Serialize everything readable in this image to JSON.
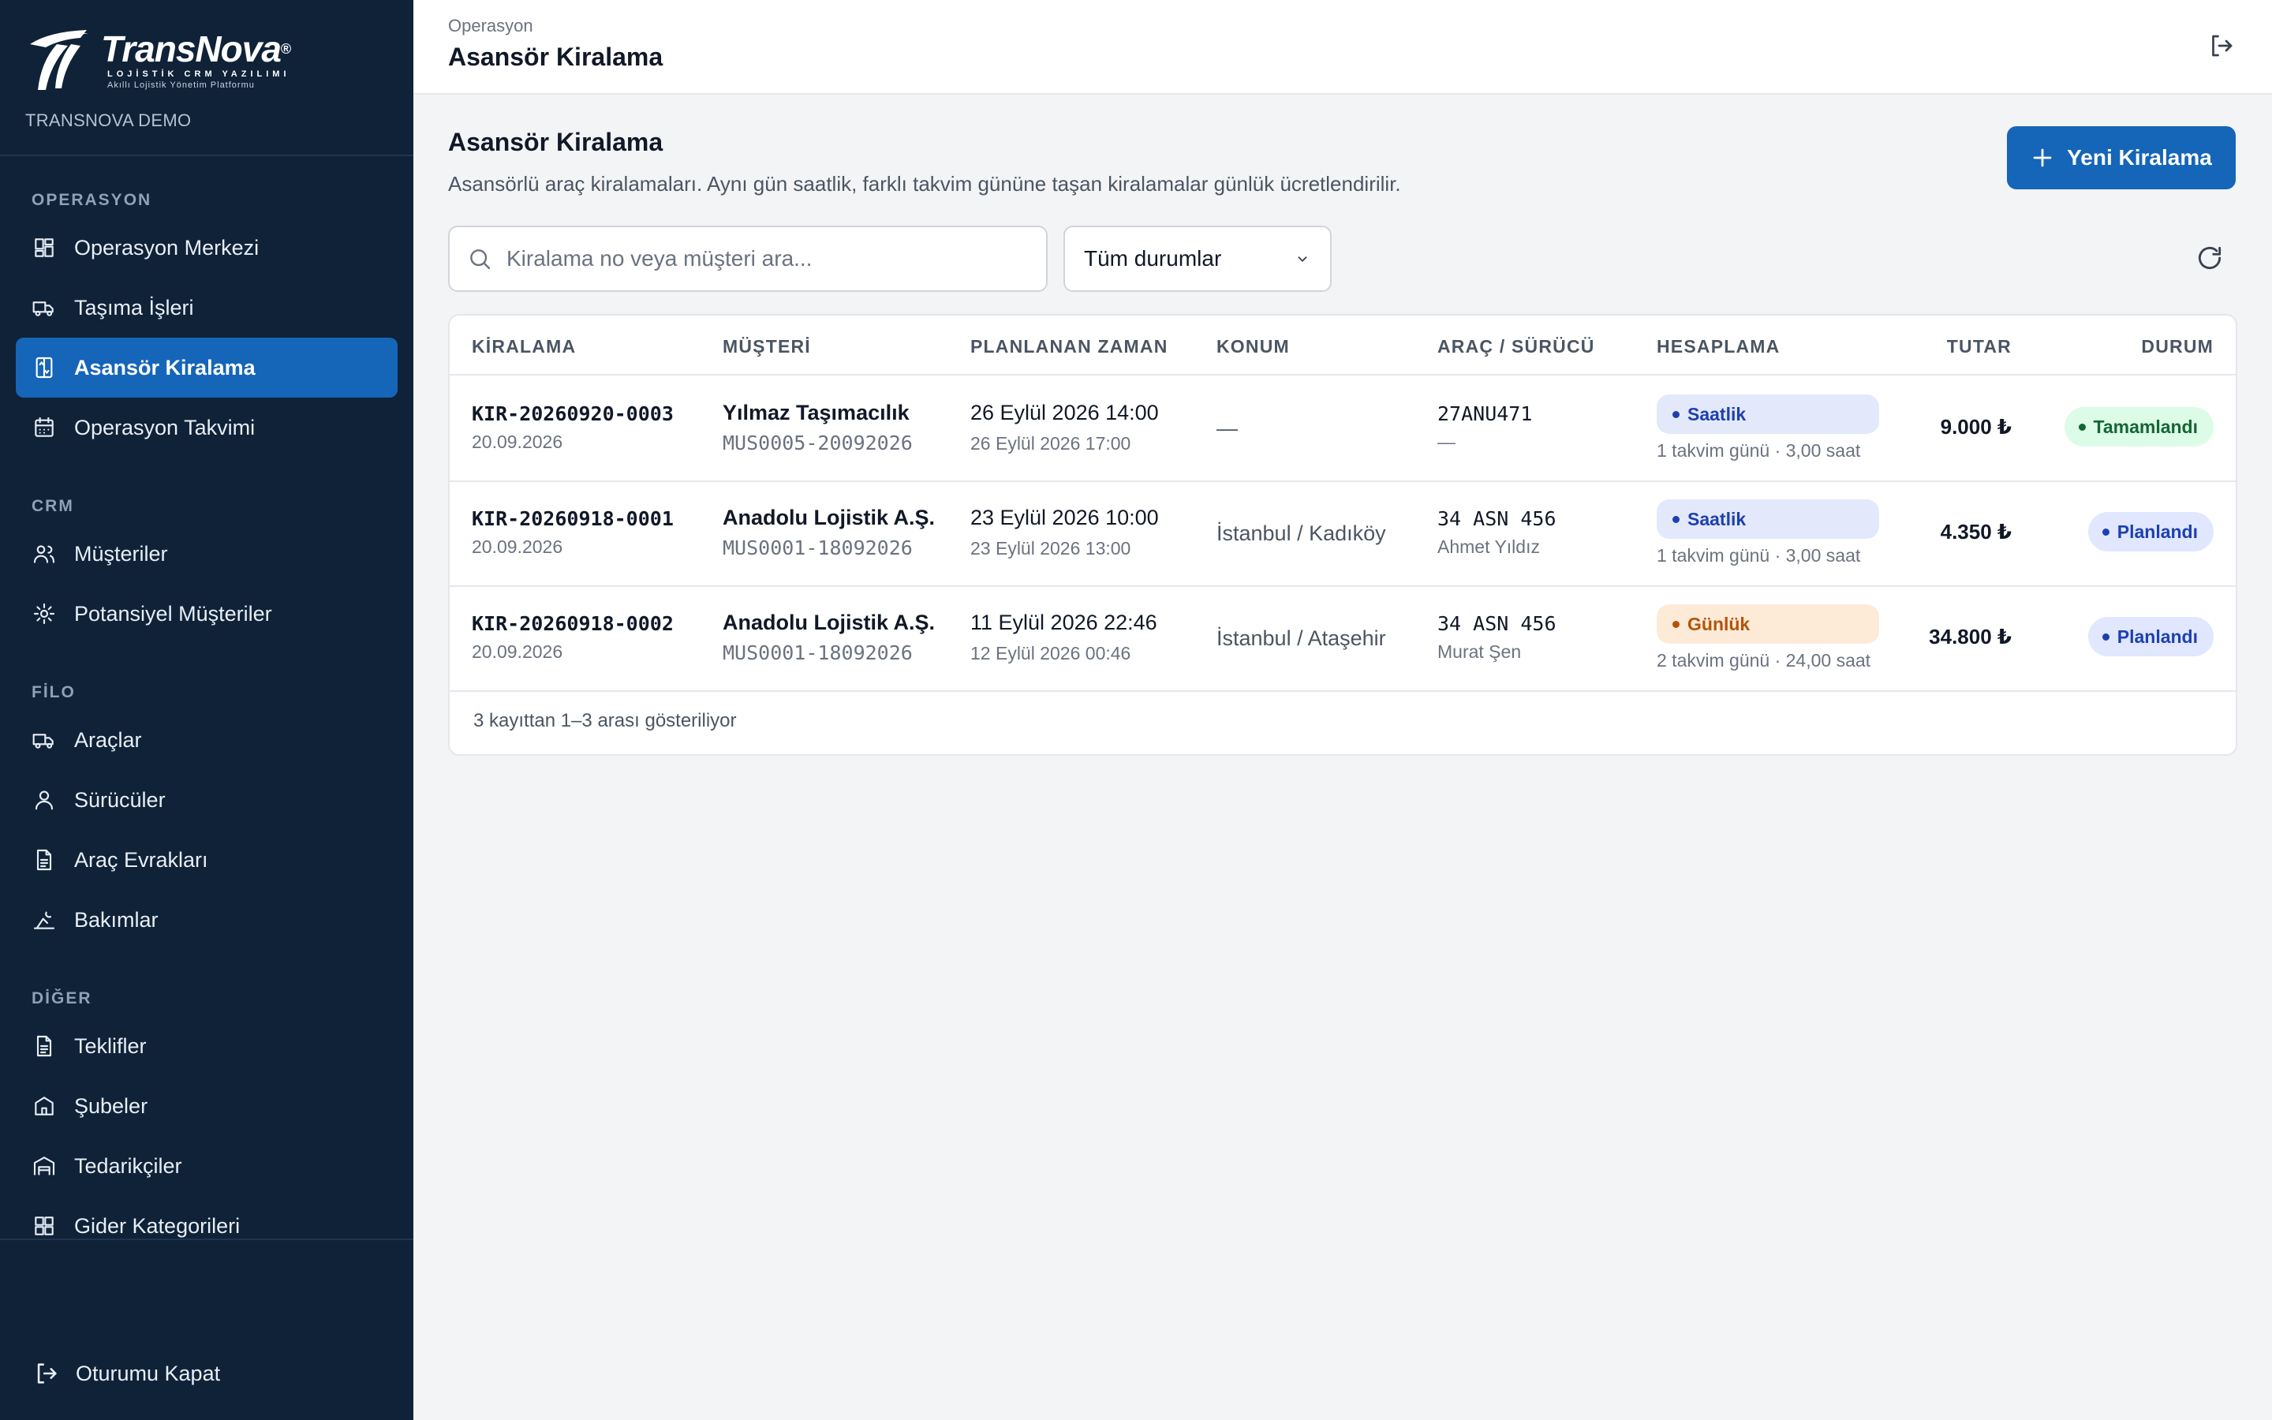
{
  "brand": {
    "name": "TransNova",
    "reg": "®",
    "tagline": "LOJİSTİK CRM YAZILIMI",
    "subtagline": "Akıllı Lojistik Yönetim Platformu",
    "workspace": "TRANSNOVA DEMO"
  },
  "sidebar": {
    "sections": [
      {
        "title": "OPERASYON",
        "items": [
          {
            "label": "Operasyon Merkezi",
            "icon": "dashboard-icon",
            "active": false
          },
          {
            "label": "Taşıma İşleri",
            "icon": "truck-icon",
            "active": false
          },
          {
            "label": "Asansör Kiralama",
            "icon": "elevator-icon",
            "active": true
          },
          {
            "label": "Operasyon Takvimi",
            "icon": "calendar-icon",
            "active": false
          }
        ]
      },
      {
        "title": "CRM",
        "items": [
          {
            "label": "Müşteriler",
            "icon": "users-icon",
            "active": false
          },
          {
            "label": "Potansiyel Müşteriler",
            "icon": "sparkle-icon",
            "active": false
          }
        ]
      },
      {
        "title": "FİLO",
        "items": [
          {
            "label": "Araçlar",
            "icon": "truck-icon",
            "active": false
          },
          {
            "label": "Sürücüler",
            "icon": "user-icon",
            "active": false
          },
          {
            "label": "Araç Evrakları",
            "icon": "document-icon",
            "active": false
          },
          {
            "label": "Bakımlar",
            "icon": "wrench-icon",
            "active": false
          }
        ]
      },
      {
        "title": "DİĞER",
        "items": [
          {
            "label": "Teklifler",
            "icon": "document-icon",
            "active": false
          },
          {
            "label": "Şubeler",
            "icon": "building-icon",
            "active": false
          },
          {
            "label": "Tedarikçiler",
            "icon": "warehouse-icon",
            "active": false
          },
          {
            "label": "Gider Kategorileri",
            "icon": "grid-icon",
            "active": false
          }
        ]
      }
    ],
    "logout_label": "Oturumu Kapat"
  },
  "topbar": {
    "breadcrumb": "Operasyon",
    "title": "Asansör Kiralama"
  },
  "page": {
    "title": "Asansör Kiralama",
    "subtitle": "Asansörlü araç kiralamaları. Aynı gün saatlik, farklı takvim gününe taşan kiralamalar günlük ücretlendirilir.",
    "new_button": "Yeni Kiralama",
    "search_placeholder": "Kiralama no veya müşteri ara...",
    "status_filter": "Tüm durumlar"
  },
  "table": {
    "columns": [
      "KİRALAMA",
      "MÜŞTERİ",
      "PLANLANAN ZAMAN",
      "KONUM",
      "ARAÇ / SÜRÜCÜ",
      "HESAPLAMA",
      "TUTAR",
      "DURUM"
    ],
    "rows": [
      {
        "id": "KIR-20260920-0003",
        "date": "20.09.2026",
        "customer": "Yılmaz Taşımacılık",
        "customer_code": "MUS0005-20092026",
        "start": "26 Eylül 2026 14:00",
        "end": "26 Eylül 2026 17:00",
        "location": "—",
        "plate": "27ANU471",
        "driver": "—",
        "calc_type": "Saatlik",
        "calc_kind": "hourly",
        "calc_note": "1 takvim günü · 3,00 saat",
        "amount": "9.000 ₺",
        "status": "Tamamlandı",
        "status_kind": "done"
      },
      {
        "id": "KIR-20260918-0001",
        "date": "20.09.2026",
        "customer": "Anadolu Lojistik A.Ş.",
        "customer_code": "MUS0001-18092026",
        "start": "23 Eylül 2026 10:00",
        "end": "23 Eylül 2026 13:00",
        "location": "İstanbul / Kadıköy",
        "plate": "34 ASN 456",
        "driver": "Ahmet Yıldız",
        "calc_type": "Saatlik",
        "calc_kind": "hourly",
        "calc_note": "1 takvim günü · 3,00 saat",
        "amount": "4.350 ₺",
        "status": "Planlandı",
        "status_kind": "planned"
      },
      {
        "id": "KIR-20260918-0002",
        "date": "20.09.2026",
        "customer": "Anadolu Lojistik A.Ş.",
        "customer_code": "MUS0001-18092026",
        "start": "11 Eylül 2026 22:46",
        "end": "12 Eylül 2026 00:46",
        "location": "İstanbul / Ataşehir",
        "plate": "34 ASN 456",
        "driver": "Murat Şen",
        "calc_type": "Günlük",
        "calc_kind": "daily",
        "calc_note": "2 takvim günü · 24,00 saat",
        "amount": "34.800 ₺",
        "status": "Planlandı",
        "status_kind": "planned"
      }
    ],
    "footer": "3 kayıttan 1–3 arası gösteriliyor"
  },
  "colors": {
    "sidebar_bg": "#0f2238",
    "accent": "#1565b8",
    "status_done": "#166534",
    "status_planned": "#1e40af",
    "calc_daily": "#b45309"
  }
}
